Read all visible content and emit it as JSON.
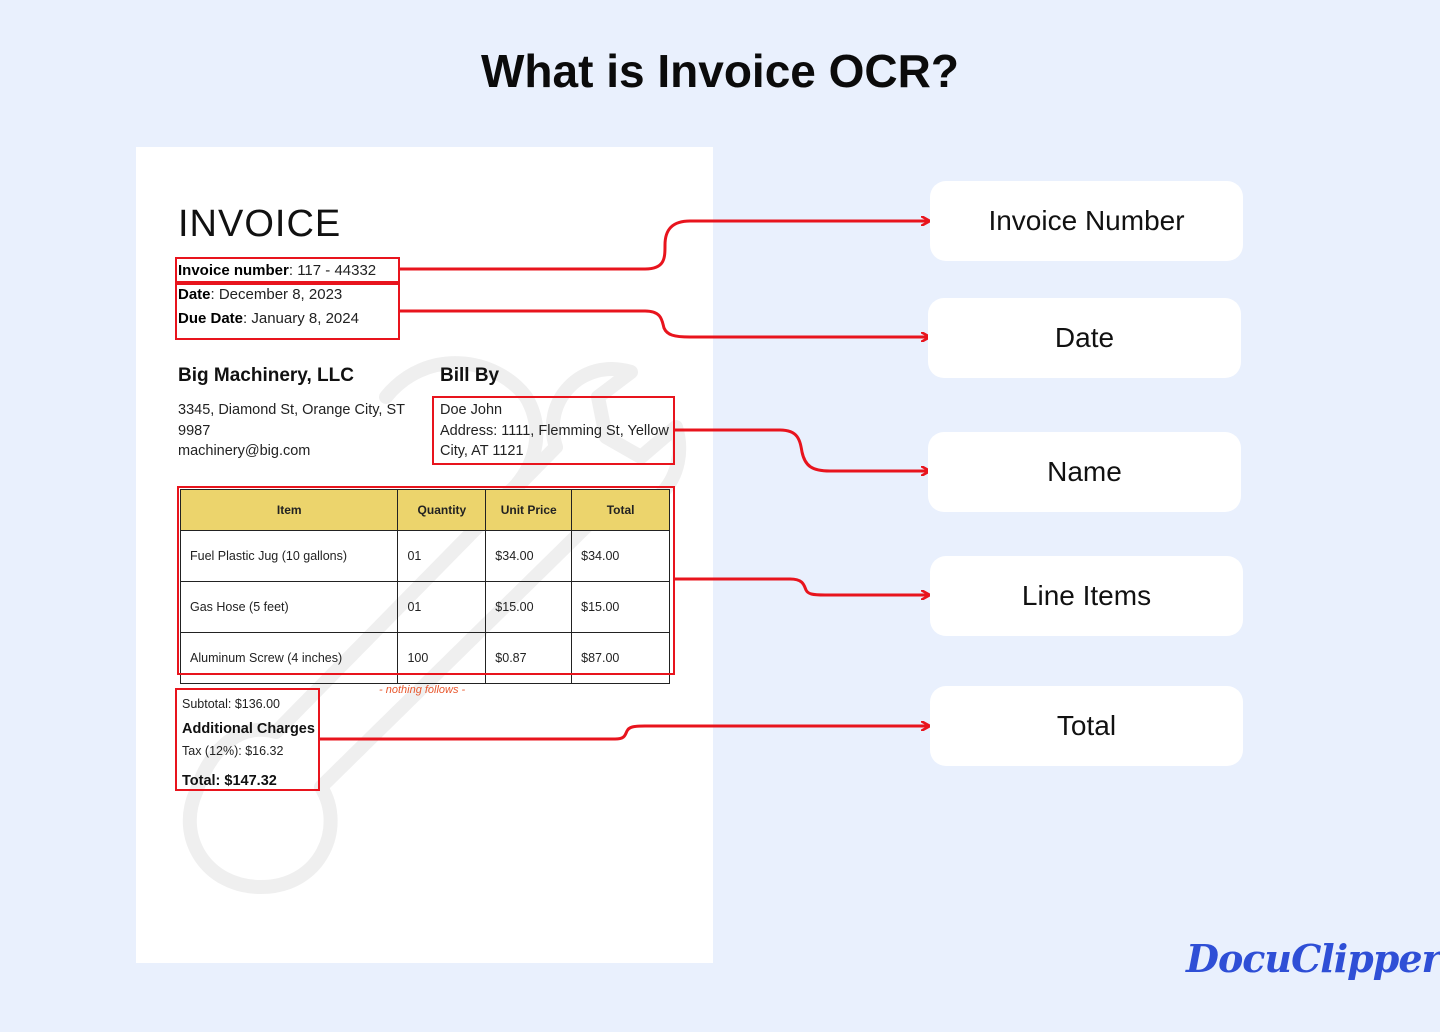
{
  "title": "What is Invoice OCR?",
  "invoice": {
    "heading": "INVOICE",
    "number_label": "Invoice number",
    "number_value": ": 117 - 44332",
    "date_label": "Date",
    "date_value": ": December 8, 2023",
    "due_label": "Due Date",
    "due_value": ": January 8, 2024",
    "company_name": "Big Machinery, LLC",
    "company_address_1": "3345, Diamond St, Orange City, ST",
    "company_address_2": "9987",
    "company_email": "machinery@big.com",
    "bill_by_label": "Bill By",
    "bill_name": "Doe John",
    "bill_address_1": "Address: 1111, Flemming St, Yellow",
    "bill_address_2": "City, AT 1121",
    "table": {
      "headers": [
        "Item",
        "Quantity",
        "Unit Price",
        "Total"
      ],
      "rows": [
        [
          "Fuel Plastic Jug (10 gallons)",
          "01",
          "$34.00",
          "$34.00"
        ],
        [
          "Gas Hose (5 feet)",
          "01",
          "$15.00",
          "$15.00"
        ],
        [
          "Aluminum Screw (4 inches)",
          "100",
          "$0.87",
          "$87.00"
        ]
      ]
    },
    "nothing_follows": "- nothing follows -",
    "subtotal": "Subtotal: $136.00",
    "additional_label": "Additional Charges",
    "tax": "Tax (12%): $16.32",
    "total": "Total: $147.32"
  },
  "labels": {
    "invoice_number": "Invoice Number",
    "date": "Date",
    "name": "Name",
    "line_items": "Line Items",
    "total": "Total"
  },
  "brand": "DocuClipper",
  "colors": {
    "background": "#e9f0fd",
    "highlight_red": "#e8141d",
    "table_header": "#ecd46c",
    "brand_blue": "#2f4fd6"
  }
}
